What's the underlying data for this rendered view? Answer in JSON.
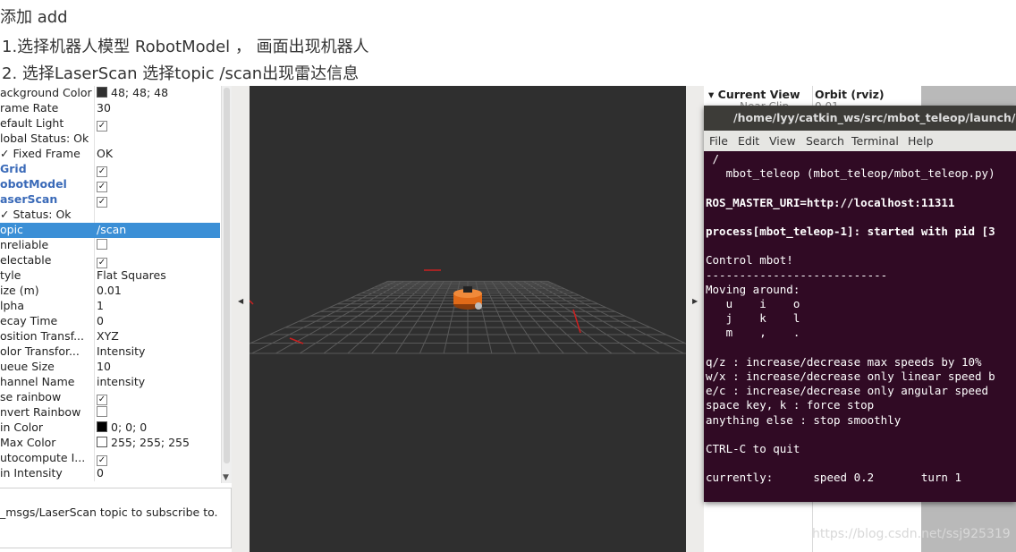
{
  "intro": {
    "line1": "添加 add",
    "line2": "1.选择机器人模型 RobotModel ， 画面出现机器人",
    "line3": "2. 选择LaserScan 选择topic /scan出现雷达信息"
  },
  "properties": [
    {
      "key": "ackground Color",
      "value": "48; 48; 48",
      "swatch": "#303030"
    },
    {
      "key": "rame Rate",
      "value": "30"
    },
    {
      "key": "efault Light",
      "check": "✓"
    },
    {
      "key": "lobal Status: Ok",
      "value": ""
    },
    {
      "key": "✓  Fixed Frame",
      "value": "OK"
    },
    {
      "key": "Grid",
      "check": "✓",
      "style": "blue"
    },
    {
      "key": "obotModel",
      "check": "✓",
      "style": "blue"
    },
    {
      "key": "aserScan",
      "check": "✓",
      "style": "blue"
    },
    {
      "key": "✓  Status: Ok",
      "value": ""
    },
    {
      "key": "opic",
      "value": "/scan",
      "style": "sel"
    },
    {
      "key": "nreliable",
      "check": ""
    },
    {
      "key": "electable",
      "check": "✓"
    },
    {
      "key": "tyle",
      "value": "Flat Squares"
    },
    {
      "key": "ize (m)",
      "value": "0.01"
    },
    {
      "key": "lpha",
      "value": "1"
    },
    {
      "key": "ecay Time",
      "value": "0"
    },
    {
      "key": "osition Transf...",
      "value": "XYZ"
    },
    {
      "key": "olor Transfor...",
      "value": "Intensity"
    },
    {
      "key": "ueue Size",
      "value": "10"
    },
    {
      "key": "hannel Name",
      "value": "intensity"
    },
    {
      "key": "se rainbow",
      "check": "✓"
    },
    {
      "key": "nvert Rainbow",
      "check": ""
    },
    {
      "key": "in Color",
      "value": "0; 0; 0",
      "swatch": "#000000"
    },
    {
      "key": "Max Color",
      "value": "255; 255; 255",
      "swatch": "#ffffff"
    },
    {
      "key": "utocompute I...",
      "check": "✓"
    },
    {
      "key": "in Intensity",
      "value": "0"
    }
  ],
  "description": "_msgs/LaserScan topic to subscribe to.",
  "views_panel": {
    "current_view": "Current View",
    "current_view_value": "Orbit (rviz)",
    "near_clip": "Near Clip",
    "near_clip_value": "0.01"
  },
  "terminal": {
    "title": "/home/lyy/catkin_ws/src/mbot_teleop/launch/mbot",
    "menu": [
      "File",
      "Edit",
      "View",
      "Search",
      "Terminal",
      "Help"
    ],
    "lines": [
      {
        "t": " /",
        "b": false
      },
      {
        "t": "   mbot_teleop (mbot_teleop/mbot_teleop.py)",
        "b": false
      },
      {
        "t": "",
        "b": false
      },
      {
        "t": "ROS_MASTER_URI=http://localhost:11311",
        "b": true
      },
      {
        "t": "",
        "b": false
      },
      {
        "t": "process[mbot_teleop-1]: started with pid [3",
        "b": true
      },
      {
        "t": "",
        "b": false
      },
      {
        "t": "Control mbot!",
        "b": false
      },
      {
        "t": "---------------------------",
        "b": false
      },
      {
        "t": "Moving around:",
        "b": false
      },
      {
        "t": "   u    i    o",
        "b": false
      },
      {
        "t": "   j    k    l",
        "b": false
      },
      {
        "t": "   m    ,    .",
        "b": false
      },
      {
        "t": "",
        "b": false
      },
      {
        "t": "q/z : increase/decrease max speeds by 10%",
        "b": false
      },
      {
        "t": "w/x : increase/decrease only linear speed b",
        "b": false
      },
      {
        "t": "e/c : increase/decrease only angular speed",
        "b": false
      },
      {
        "t": "space key, k : force stop",
        "b": false
      },
      {
        "t": "anything else : stop smoothly",
        "b": false
      },
      {
        "t": "",
        "b": false
      },
      {
        "t": "CTRL-C to quit",
        "b": false
      },
      {
        "t": "",
        "b": false
      },
      {
        "t": "currently:      speed 0.2       turn 1",
        "b": false
      }
    ]
  },
  "watermark": "https://blog.csdn.net/ssj925319",
  "colors": {
    "viewport_bg": "#2f2f2f",
    "grid": "#5a5a5a",
    "robot": "#e06a18",
    "laser": "#cc2020",
    "terminal_bg": "#300a24",
    "selection": "#3b8fd6"
  }
}
